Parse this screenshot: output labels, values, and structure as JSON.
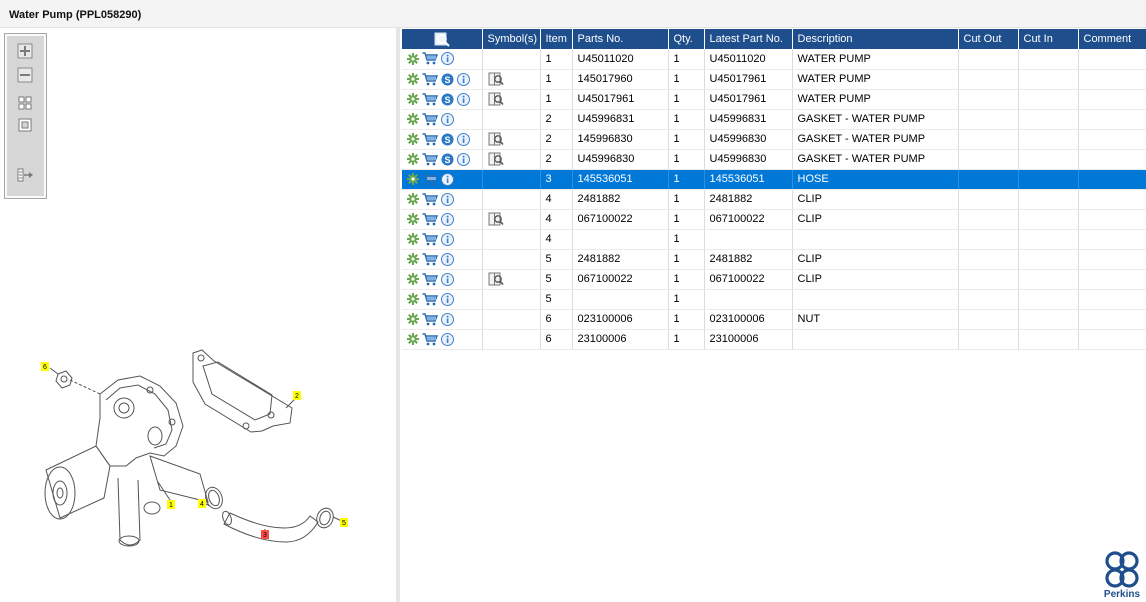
{
  "window": {
    "title": "Water Pump (PPL058290)"
  },
  "drawing": {
    "callouts": [
      "6",
      "2",
      "1",
      "4",
      "3",
      "5"
    ]
  },
  "table": {
    "headers": {
      "symbols": "Symbol(s)",
      "item": "Item",
      "parts_no": "Parts No.",
      "qty": "Qty.",
      "latest": "Latest Part No.",
      "description": "Description",
      "cut_out": "Cut Out",
      "cut_in": "Cut In",
      "comment": "Comment"
    },
    "rows": [
      {
        "s_badge": false,
        "symbol": false,
        "item": "1",
        "parts_no": "U45011020",
        "qty": "1",
        "latest": "U45011020",
        "description": "WATER PUMP"
      },
      {
        "s_badge": true,
        "symbol": true,
        "item": "1",
        "parts_no": "145017960",
        "qty": "1",
        "latest": "U45017961",
        "description": "WATER PUMP"
      },
      {
        "s_badge": true,
        "symbol": true,
        "item": "1",
        "parts_no": "U45017961",
        "qty": "1",
        "latest": "U45017961",
        "description": "WATER PUMP"
      },
      {
        "s_badge": false,
        "symbol": false,
        "item": "2",
        "parts_no": "U45996831",
        "qty": "1",
        "latest": "U45996831",
        "description": "GASKET - WATER PUMP"
      },
      {
        "s_badge": true,
        "symbol": true,
        "item": "2",
        "parts_no": "145996830",
        "qty": "1",
        "latest": "U45996830",
        "description": "GASKET - WATER PUMP"
      },
      {
        "s_badge": true,
        "symbol": true,
        "item": "2",
        "parts_no": "U45996830",
        "qty": "1",
        "latest": "U45996830",
        "description": "GASKET - WATER PUMP"
      },
      {
        "s_badge": false,
        "symbol": false,
        "item": "3",
        "parts_no": "145536051",
        "qty": "1",
        "latest": "145536051",
        "description": "HOSE",
        "selected": true
      },
      {
        "s_badge": false,
        "symbol": false,
        "item": "4",
        "parts_no": "2481882",
        "qty": "1",
        "latest": "2481882",
        "description": "CLIP"
      },
      {
        "s_badge": false,
        "symbol": true,
        "item": "4",
        "parts_no": "067100022",
        "qty": "1",
        "latest": "067100022",
        "description": "CLIP"
      },
      {
        "s_badge": false,
        "symbol": false,
        "item": "4",
        "parts_no": "",
        "qty": "1",
        "latest": "",
        "description": ""
      },
      {
        "s_badge": false,
        "symbol": false,
        "item": "5",
        "parts_no": "2481882",
        "qty": "1",
        "latest": "2481882",
        "description": "CLIP"
      },
      {
        "s_badge": false,
        "symbol": true,
        "item": "5",
        "parts_no": "067100022",
        "qty": "1",
        "latest": "067100022",
        "description": "CLIP"
      },
      {
        "s_badge": false,
        "symbol": false,
        "item": "5",
        "parts_no": "",
        "qty": "1",
        "latest": "",
        "description": ""
      },
      {
        "s_badge": false,
        "symbol": false,
        "item": "6",
        "parts_no": "023100006",
        "qty": "1",
        "latest": "023100006",
        "description": "NUT"
      },
      {
        "s_badge": false,
        "symbol": false,
        "item": "6",
        "parts_no": "23100006",
        "qty": "1",
        "latest": "23100006",
        "description": ""
      }
    ]
  },
  "brand": {
    "logo_text": "Perkins",
    "color": "#1f4e8c"
  },
  "colors": {
    "header_bg": "#1f4e8c",
    "selected_row": "#0078d7",
    "callout_yellow": "#ffff00",
    "callout_red": "#ff4a4a"
  }
}
